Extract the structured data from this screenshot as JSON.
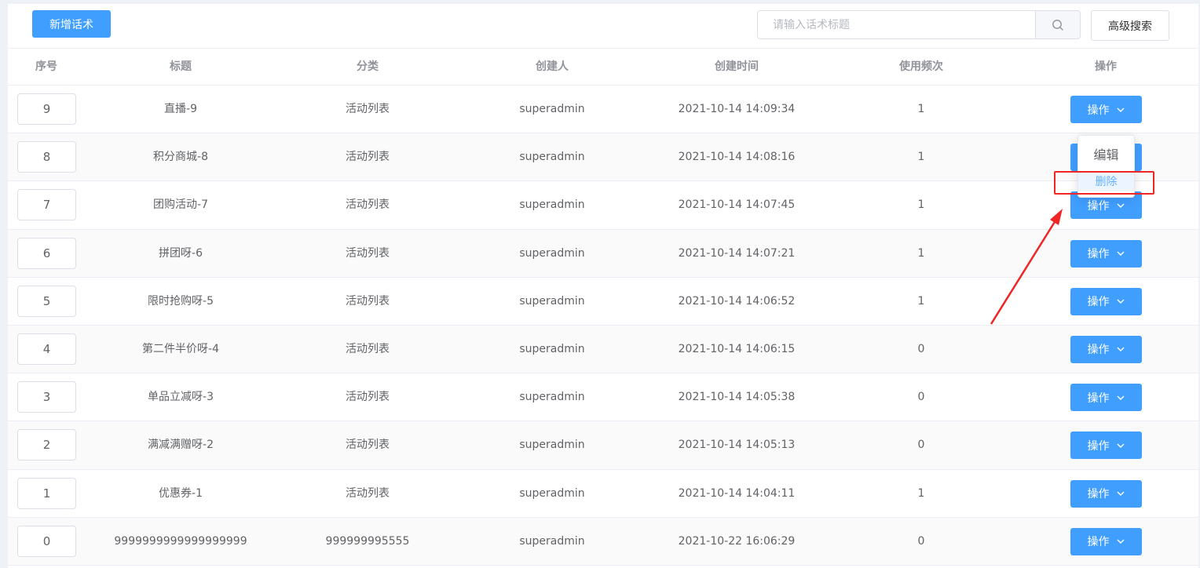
{
  "toolbar": {
    "add_label": "新增话术",
    "search_placeholder": "请输入话术标题",
    "search_icon": "search-icon",
    "advanced_label": "高级搜索"
  },
  "table": {
    "columns": [
      "序号",
      "标题",
      "分类",
      "创建人",
      "创建时间",
      "使用频次",
      "操作"
    ],
    "rows": [
      {
        "seq": "9",
        "title": "直播-9",
        "category": "活动列表",
        "creator": "superadmin",
        "created": "2021-10-14 14:09:34",
        "freq": "1",
        "op": "操作"
      },
      {
        "seq": "8",
        "title": "积分商城-8",
        "category": "活动列表",
        "creator": "superadmin",
        "created": "2021-10-14 14:08:16",
        "freq": "1",
        "op": "操作"
      },
      {
        "seq": "7",
        "title": "团购活动-7",
        "category": "活动列表",
        "creator": "superadmin",
        "created": "2021-10-14 14:07:45",
        "freq": "1",
        "op": "操作"
      },
      {
        "seq": "6",
        "title": "拼团呀-6",
        "category": "活动列表",
        "creator": "superadmin",
        "created": "2021-10-14 14:07:21",
        "freq": "1",
        "op": "操作"
      },
      {
        "seq": "5",
        "title": "限时抢购呀-5",
        "category": "活动列表",
        "creator": "superadmin",
        "created": "2021-10-14 14:06:52",
        "freq": "1",
        "op": "操作"
      },
      {
        "seq": "4",
        "title": "第二件半价呀-4",
        "category": "活动列表",
        "creator": "superadmin",
        "created": "2021-10-14 14:06:15",
        "freq": "0",
        "op": "操作"
      },
      {
        "seq": "3",
        "title": "单品立减呀-3",
        "category": "活动列表",
        "creator": "superadmin",
        "created": "2021-10-14 14:05:38",
        "freq": "0",
        "op": "操作"
      },
      {
        "seq": "2",
        "title": "满减满赠呀-2",
        "category": "活动列表",
        "creator": "superadmin",
        "created": "2021-10-14 14:05:13",
        "freq": "0",
        "op": "操作"
      },
      {
        "seq": "1",
        "title": "优惠券-1",
        "category": "活动列表",
        "creator": "superadmin",
        "created": "2021-10-14 14:04:11",
        "freq": "1",
        "op": "操作"
      },
      {
        "seq": "0",
        "title": "9999999999999999999",
        "category": "999999995555",
        "creator": "superadmin",
        "created": "2021-10-22 16:06:29",
        "freq": "0",
        "op": "操作"
      }
    ]
  },
  "dropdown": {
    "edit_label": "编辑",
    "delete_label": "删除"
  },
  "colors": {
    "primary": "#409eff",
    "highlight": "#f02525"
  }
}
